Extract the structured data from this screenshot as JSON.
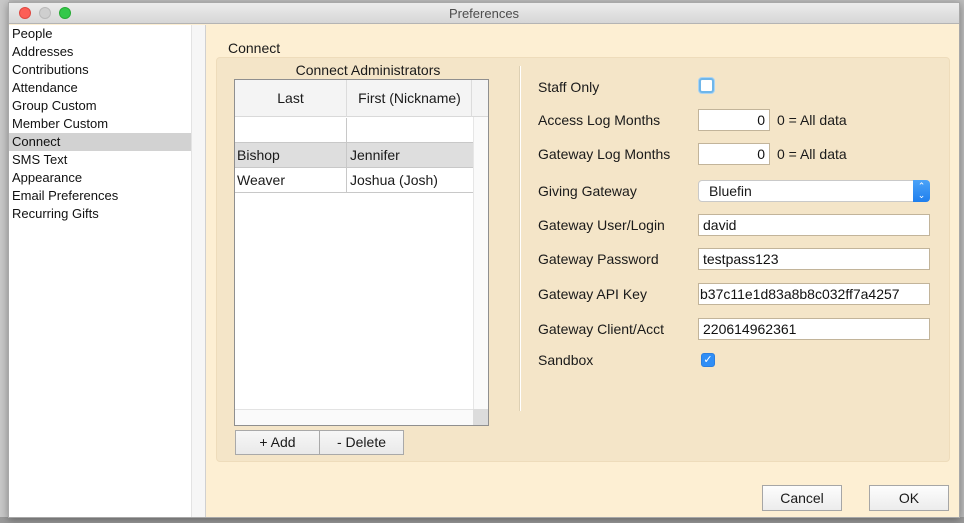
{
  "window": {
    "title": "Preferences"
  },
  "sidebar": {
    "items": [
      {
        "label": "People",
        "selected": false
      },
      {
        "label": "Addresses",
        "selected": false
      },
      {
        "label": "Contributions",
        "selected": false
      },
      {
        "label": "Attendance",
        "selected": false
      },
      {
        "label": "Group Custom",
        "selected": false
      },
      {
        "label": "Member Custom",
        "selected": false
      },
      {
        "label": "Connect",
        "selected": true
      },
      {
        "label": "SMS Text",
        "selected": false
      },
      {
        "label": "Appearance",
        "selected": false
      },
      {
        "label": "Email Preferences",
        "selected": false
      },
      {
        "label": "Recurring Gifts",
        "selected": false
      }
    ]
  },
  "main": {
    "section_title": "Connect",
    "administrators": {
      "title": "Connect Administrators",
      "columns": [
        "Last",
        "First (Nickname)"
      ],
      "rows": [
        {
          "last": "",
          "first": ""
        },
        {
          "last": "Bishop",
          "first": "Jennifer",
          "selected": true
        },
        {
          "last": "Weaver",
          "first": "Joshua (Josh)"
        }
      ],
      "add_label": "+ Add",
      "delete_label": "- Delete"
    },
    "form": {
      "staff_only": {
        "label": "Staff Only",
        "checked": false
      },
      "access_log_months": {
        "label": "Access Log Months",
        "value": "0",
        "hint": "0 = All data"
      },
      "gateway_log_months": {
        "label": "Gateway Log Months",
        "value": "0",
        "hint": "0 = All data"
      },
      "giving_gateway": {
        "label": "Giving Gateway",
        "value": "Bluefin"
      },
      "gateway_user": {
        "label": "Gateway User/Login",
        "value": "david"
      },
      "gateway_password": {
        "label": "Gateway Password",
        "value": "testpass123"
      },
      "gateway_api_key": {
        "label": "Gateway API Key",
        "value": "b37c11e1d83a8b8c032ff7a4257"
      },
      "gateway_client": {
        "label": "Gateway Client/Acct",
        "value": "220614962361"
      },
      "sandbox": {
        "label": "Sandbox",
        "checked": true,
        "check_glyph": "✓"
      }
    }
  },
  "footer": {
    "cancel_label": "Cancel",
    "ok_label": "OK"
  },
  "icons": {
    "select_arrows": "⌃⌄"
  }
}
